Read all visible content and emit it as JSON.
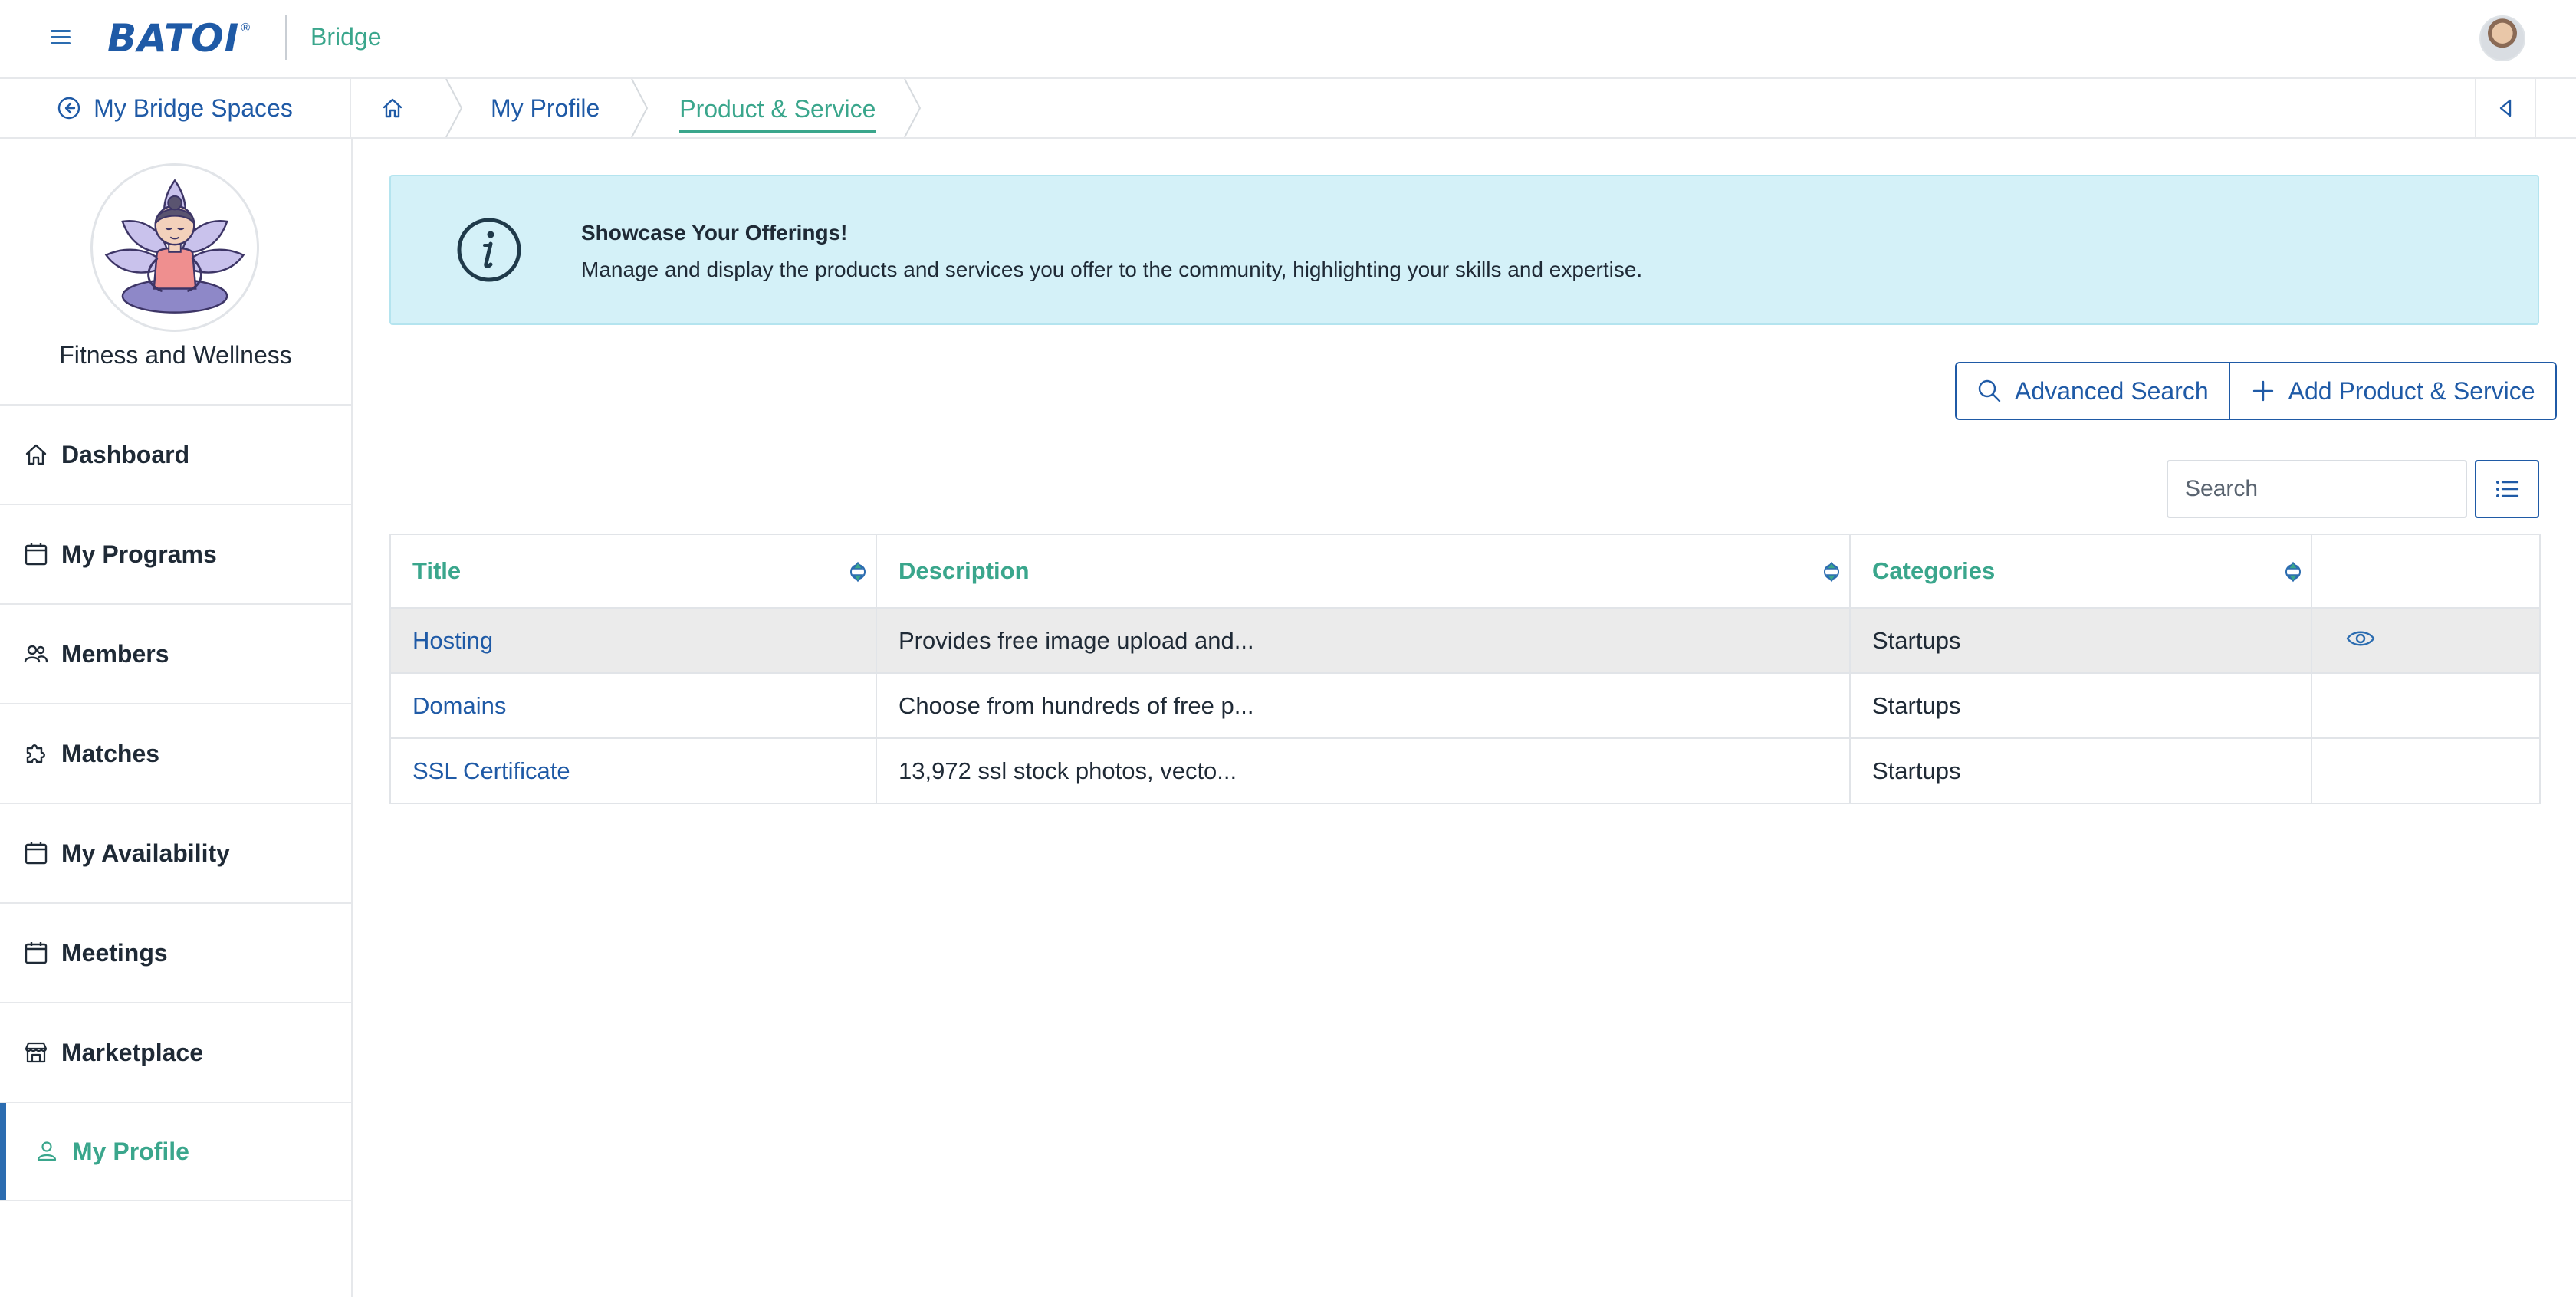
{
  "header": {
    "logo_text": "BATOI",
    "logo_mark": "®",
    "app_name": "Bridge"
  },
  "subnav": {
    "back_label": "My Bridge Spaces",
    "breadcrumbs": [
      {
        "label": "My Profile"
      },
      {
        "label": "Product & Service"
      }
    ]
  },
  "sidebar": {
    "space_name": "Fitness and Wellness",
    "items": [
      {
        "label": "Dashboard",
        "icon": "home-icon"
      },
      {
        "label": "My Programs",
        "icon": "calendar-icon"
      },
      {
        "label": "Members",
        "icon": "users-icon"
      },
      {
        "label": "Matches",
        "icon": "puzzle-icon"
      },
      {
        "label": "My Availability",
        "icon": "calendar-icon"
      },
      {
        "label": "Meetings",
        "icon": "calendar-icon"
      },
      {
        "label": "Marketplace",
        "icon": "store-icon"
      },
      {
        "label": "My Profile",
        "icon": "user-icon",
        "active": true
      }
    ]
  },
  "banner": {
    "title": "Showcase Your Offerings!",
    "text": "Manage and display the products and services you offer to the community, highlighting your skills and expertise."
  },
  "toolbar": {
    "advanced_search_label": "Advanced Search",
    "add_label": "Add Product & Service",
    "search_placeholder": "Search"
  },
  "table": {
    "columns": [
      "Title",
      "Description",
      "Categories",
      ""
    ],
    "rows": [
      {
        "title": "Hosting",
        "description": "Provides free image upload and...",
        "category": "Startups"
      },
      {
        "title": "Domains",
        "description": "Choose from hundreds of free p...",
        "category": "Startups"
      },
      {
        "title": "SSL Certificate",
        "description": "13,972 ssl stock photos, vecto...",
        "category": "Startups"
      }
    ]
  },
  "colors": {
    "primary": "#1f5aa6",
    "accent": "#3aa68c",
    "banner_bg": "#d4f1f8"
  }
}
